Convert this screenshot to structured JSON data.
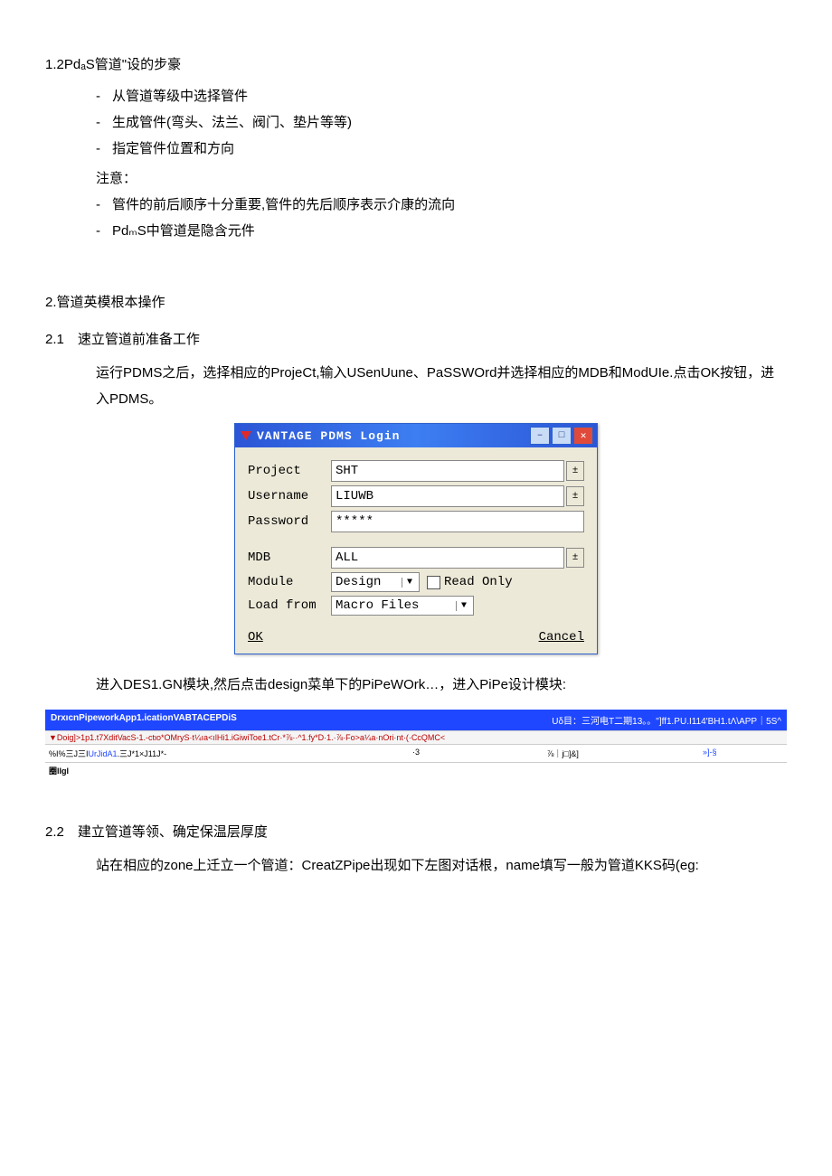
{
  "doc": {
    "s12_title": "1.2PdₐS管道\"设的步豪",
    "bullets1": [
      "从管道等级中选择管件",
      "生成管件(弯头、法兰、阀门、垫片等等)",
      "指定管件位置和方向"
    ],
    "note_label": "注意：",
    "bullets2": [
      "管件的前后顺序十分重要,管件的先后顺序表示介康的流向",
      "PdₘS中管道是隐含元件"
    ],
    "s2_title": "2.管道英模根本操作",
    "s21_title": "2.1　速立管道前准备工作",
    "s21_para": "运行PDMS之后，选择相应的ProjeCt,输入USenUune、PaSSWOrd并选择相应的MDB和ModUIe.点击OK按钮，进入PDMS。",
    "after_dialog": "进入DES1.GN模块,然后点击design菜单下的PiPeWOrk…，进入PiPe设计模块:",
    "s22_title": "2.2　建立管道等领、确定保温层厚度",
    "s22_para": "站在相应的zone上迁立一个管道：CreatZPipe出现如下左图对话根，name填写一般为管道KKS码(eg:"
  },
  "dialog": {
    "title": "VANTAGE PDMS Login",
    "labels": {
      "project": "Project",
      "username": "Username",
      "password": "Password",
      "mdb": "MDB",
      "module": "Module",
      "loadfrom": "Load from",
      "readonly": "Read Only"
    },
    "values": {
      "project": "SHT",
      "username": "LIUWB",
      "password": "*****",
      "mdb": "ALL",
      "module": "Design",
      "loadfrom": "Macro Files"
    },
    "buttons": {
      "ok": "OK",
      "cancel": "Cancel"
    },
    "win": {
      "min": "–",
      "max": "□",
      "close": "✕"
    }
  },
  "appbar": {
    "left": "DrxıcnPipeworkApp1.icationVABTACEPDiS",
    "right": "Uδ目：三河电T二期13。。\"]ff1.PU.I114'BH1.tΛ\\APP｜5S^"
  },
  "menubar": {
    "text": "▼Doig]>1p1.t7XditVacS-1.-ctιo*OMryS·t¼ıa<ılHi1.iGiwiToe1.tCr·*⅞··^1.fy*D·1.·⅞·Fo>a¼a·nOri·nt·(·CcQMC<"
  },
  "toolbar": {
    "c1": "%I%三J三IUrJidA1.三J*1×J11J*-",
    "c2": "·3",
    "c3": "⅞｜j□]&]",
    "c4": "»]-§"
  },
  "statusbar": {
    "text": "圈lIgl"
  }
}
